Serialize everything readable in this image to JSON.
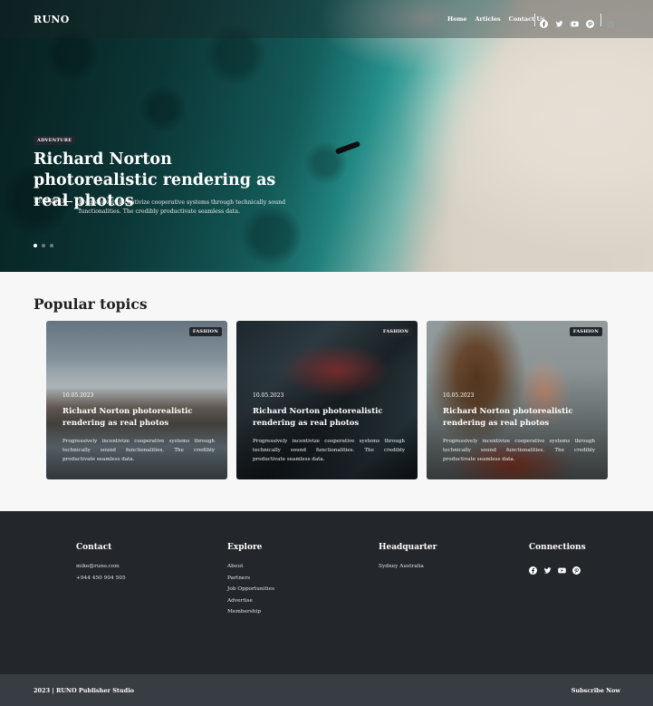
{
  "brand": "RUNO",
  "nav": {
    "links": [
      "Home",
      "Articles",
      "Contact Us"
    ],
    "social_icons": [
      "facebook-icon",
      "twitter-icon",
      "youtube-icon",
      "pinterest-icon"
    ],
    "search_icon": "search-icon"
  },
  "hero": {
    "tag": "ADVENTURE",
    "title": "Richard Norton photorealistic rendering as real photos",
    "date": "10.05.2023",
    "excerpt": "Progressively incentivize cooperative systems through technically sound functionalities. The credibly productivate seamless data.",
    "slides": 3,
    "active_slide": 1
  },
  "popular": {
    "title": "Popular topics",
    "cards": [
      {
        "tag": "FASHION",
        "date": "10.05.2023",
        "title": "Richard Norton photorealistic rendering as real photos",
        "excerpt": "Progressively incentivize cooperative systems through technically sound functionalities. The credibly productivate seamless data."
      },
      {
        "tag": "FASHION",
        "date": "10.05.2023",
        "title": "Richard Norton photorealistic rendering as real photos",
        "excerpt": "Progressively incentivize cooperative systems through technically sound functionalities. The credibly productivate seamless data."
      },
      {
        "tag": "FASHION",
        "date": "10.05.2023",
        "title": "Richard Norton photorealistic rendering as real photos",
        "excerpt": "Progressively incentivize cooperative systems through technically sound functionalities. The credibly productivate seamless data."
      }
    ]
  },
  "footer": {
    "contact": {
      "title": "Contact",
      "email": "mike@runo.com",
      "phone": "+944 450 904 505"
    },
    "explore": {
      "title": "Explore",
      "items": [
        "About",
        "Partners",
        "Job Opportunities",
        "Advertise",
        "Membership"
      ]
    },
    "headquarter": {
      "title": "Headquarter",
      "address": "Sydney Australia"
    },
    "connections": {
      "title": "Connections",
      "icons": [
        "facebook-icon",
        "twitter-icon",
        "youtube-icon",
        "pinterest-icon"
      ]
    },
    "copyright": "2023 | RUNO Publisher Studio",
    "subscribe": "Subscribe Now"
  }
}
